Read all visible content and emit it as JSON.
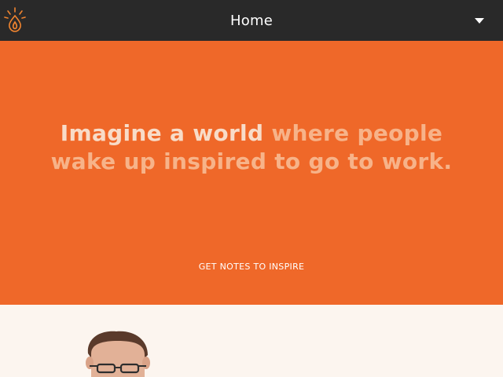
{
  "header": {
    "title": "Home",
    "logo_icon": "flame-logo-icon",
    "menu_icon": "caret-down-icon",
    "background": "#292929"
  },
  "hero": {
    "background": "#ef6829",
    "headline_line1_strong": "Imagine a world",
    "headline_line1_soft": " where people",
    "headline_line2": "wake up inspired to go to work.",
    "cta_label": "GET NOTES TO INSPIRE"
  },
  "lower": {
    "background": "#fcf5ef",
    "image": "portrait-photo"
  }
}
